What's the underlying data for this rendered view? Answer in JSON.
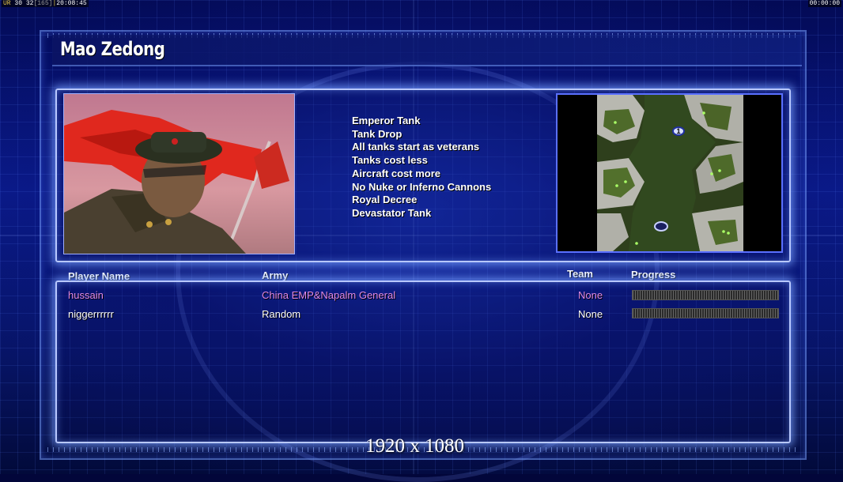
{
  "status": {
    "left_label": "UR",
    "left_fps": "30 32",
    "left_bracket": "[165]",
    "left_clock": "20:08:45",
    "right_clock": "00:00:00"
  },
  "general": {
    "name": "Mao Zedong",
    "powers": [
      "Emperor Tank",
      "Tank Drop",
      "All tanks start as veterans",
      "Tanks cost less",
      "Aircraft cost more",
      "No Nuke or Inferno Cannons",
      "Royal Decree",
      "Devastator Tank"
    ]
  },
  "minimap": {
    "start_positions": [
      "1",
      ""
    ]
  },
  "players": {
    "headers": {
      "name": "Player Name",
      "army": "Army",
      "team": "Team",
      "progress": "Progress"
    },
    "rows": [
      {
        "name": "hussain",
        "army": "China EMP&Napalm General",
        "team": "None",
        "color": "#e08ae8",
        "progress": 1.0
      },
      {
        "name": "niggerrrrrr",
        "army": "Random",
        "team": "None",
        "color": "#ffffff",
        "progress": 1.0
      }
    ]
  },
  "overlay": {
    "resolution": "1920 x 1080"
  },
  "colors": {
    "background": "#0a1a8a",
    "panel_border": "#b8c8ff",
    "player1": "#e08ae8",
    "player2": "#ffffff"
  }
}
